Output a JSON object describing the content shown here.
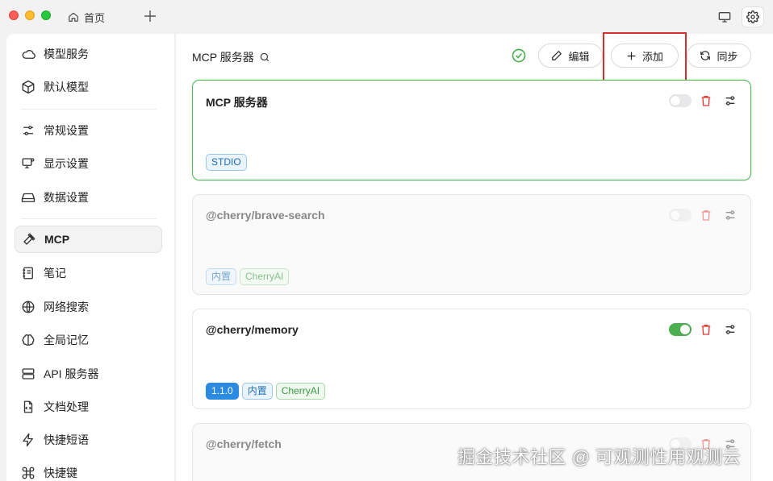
{
  "titlebar": {
    "tab_label": "首页",
    "icons": [
      "home-icon",
      "plus-icon",
      "monitor-icon",
      "gear-icon"
    ]
  },
  "sidebar": {
    "items": [
      {
        "label": "模型服务",
        "icon": "cloud-icon"
      },
      {
        "label": "默认模型",
        "icon": "cube-icon"
      },
      {
        "label": "常规设置",
        "icon": "sliders-icon"
      },
      {
        "label": "显示设置",
        "icon": "display-icon"
      },
      {
        "label": "数据设置",
        "icon": "drive-icon"
      },
      {
        "label": "MCP",
        "icon": "hammer-icon",
        "active": true
      },
      {
        "label": "笔记",
        "icon": "notebook-icon"
      },
      {
        "label": "网络搜索",
        "icon": "globe-icon"
      },
      {
        "label": "全局记忆",
        "icon": "brain-icon"
      },
      {
        "label": "API 服务器",
        "icon": "server-icon"
      },
      {
        "label": "文档处理",
        "icon": "file-code-icon"
      },
      {
        "label": "快捷短语",
        "icon": "zap-icon"
      },
      {
        "label": "快捷键",
        "icon": "command-icon"
      }
    ]
  },
  "main": {
    "title": "MCP 服务器",
    "edit_label": "编辑",
    "add_label": "添加",
    "sync_label": "同步",
    "accent_color": "#52b95a",
    "cards": [
      {
        "title": "MCP 服务器",
        "enabled": false,
        "active": true,
        "tags": [
          "STDIO"
        ]
      },
      {
        "title": "@cherry/brave-search",
        "enabled": false,
        "active": false,
        "tags": [
          "内置",
          "CherryAI"
        ]
      },
      {
        "title": "@cherry/memory",
        "enabled": true,
        "active": false,
        "tags": [
          "1.1.0",
          "内置",
          "CherryAI"
        ]
      },
      {
        "title": "@cherry/fetch",
        "enabled": false,
        "active": false,
        "tags": []
      }
    ]
  },
  "watermark": "掘金技术社区 @ 可观测性用观测云"
}
